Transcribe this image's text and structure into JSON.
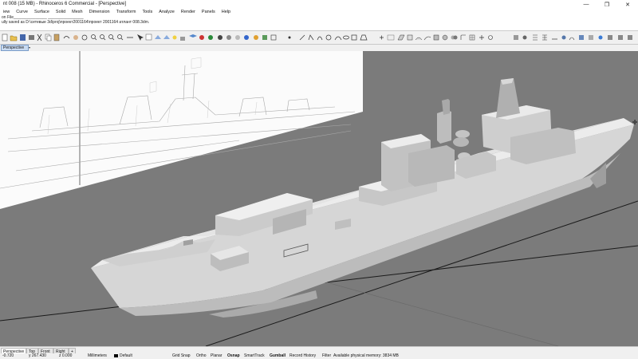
{
  "titlebar": {
    "title": "nt 008 (15 MB) - Rhinoceros 6 Commercial - [Perspective]"
  },
  "window_buttons": {
    "minimize": "—",
    "maximize": "❐",
    "close": "✕"
  },
  "menu": [
    "iew",
    "Curve",
    "Surface",
    "Solid",
    "Mesh",
    "Dimension",
    "Transform",
    "Tools",
    "Analyze",
    "Render",
    "Panels",
    "Help"
  ],
  "command_history": [
    "on File_______________ ________________",
    "ully saved as D:\\сетевые 3d\\proj\\проект2001164\\проект 2001164 атлант 008.3dm."
  ],
  "viewport": {
    "active_tab": "Perspective",
    "tab_dropdown": "▾",
    "cursor_glyph": "✛"
  },
  "bottom_tabs": [
    "Perspective",
    "Top",
    "Front",
    "Right",
    "+"
  ],
  "status": {
    "x": "-0.720",
    "y": "y 267.430",
    "z": "z 0.000",
    "units": "Millimeters",
    "layer": "Default",
    "grid_snap": "Grid Snap",
    "ortho": "Ortho",
    "planar": "Planar",
    "osnap": "Osnap",
    "smarttrack": "SmartTrack",
    "gumball": "Gumball",
    "record_history": "Record History",
    "filter": "Filter",
    "memory": "Available physical memory: 3834 MB"
  },
  "colors": {
    "viewport_bg": "#7b7b7b",
    "ship": "#dcdcdc",
    "tab_active": "#c9daf0"
  }
}
